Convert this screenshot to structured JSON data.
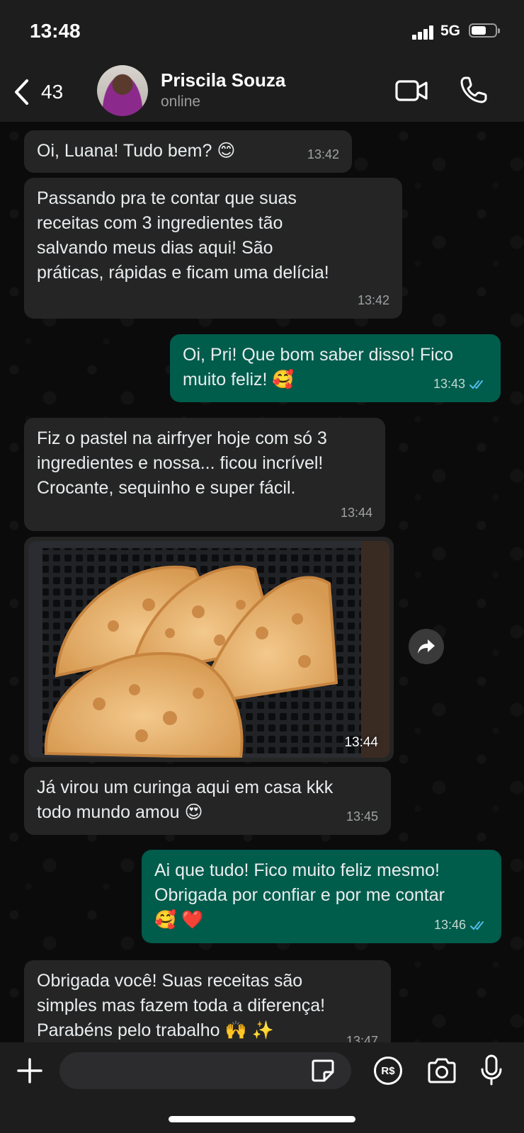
{
  "status_bar": {
    "time": "13:48",
    "network": "5G"
  },
  "header": {
    "back_count": "43",
    "contact_name": "Priscila Souza",
    "contact_status": "online"
  },
  "messages": [
    {
      "direction": "in",
      "text": "Oi, Luana! Tudo bem? 😊",
      "time": "13:42"
    },
    {
      "direction": "in",
      "text": "Passando pra te contar que suas\nreceitas com 3 ingredientes tão\nsalvando meus dias aqui! São\npráticas, rápidas e ficam uma delícia!",
      "time": "13:42"
    },
    {
      "direction": "out",
      "text": "Oi, Pri! Que bom saber disso! Fico\nmuito feliz! 🥰",
      "time": "13:43",
      "read": true
    },
    {
      "direction": "in",
      "text": "Fiz o pastel na airfryer hoje com só 3\ningredientes e nossa... ficou incrível!\nCrocante, sequinho e super fácil.",
      "time": "13:44"
    },
    {
      "direction": "in",
      "type": "image",
      "image_subject": "pastel-airfryer-photo",
      "time": "13:44"
    },
    {
      "direction": "in",
      "text": "Já virou um curinga aqui em casa kkk\ntodo mundo amou 😍",
      "time": "13:45"
    },
    {
      "direction": "out",
      "text": "Ai que tudo! Fico muito feliz mesmo!\nObrigada por confiar e por me contar\n🥰 ❤️",
      "time": "13:46",
      "read": true
    },
    {
      "direction": "in",
      "text": "Obrigada você! Suas receitas são\nsimples mas fazem toda a diferença!\nParabéns pelo trabalho 🙌 ✨",
      "time": "13:47"
    }
  ],
  "input_bar": {
    "placeholder": "",
    "payment_label": "R$"
  },
  "colors": {
    "incoming_bubble": "#252525",
    "outgoing_bubble": "#005c4b",
    "read_ticks": "#53bdeb",
    "background": "#0b0b0b"
  }
}
